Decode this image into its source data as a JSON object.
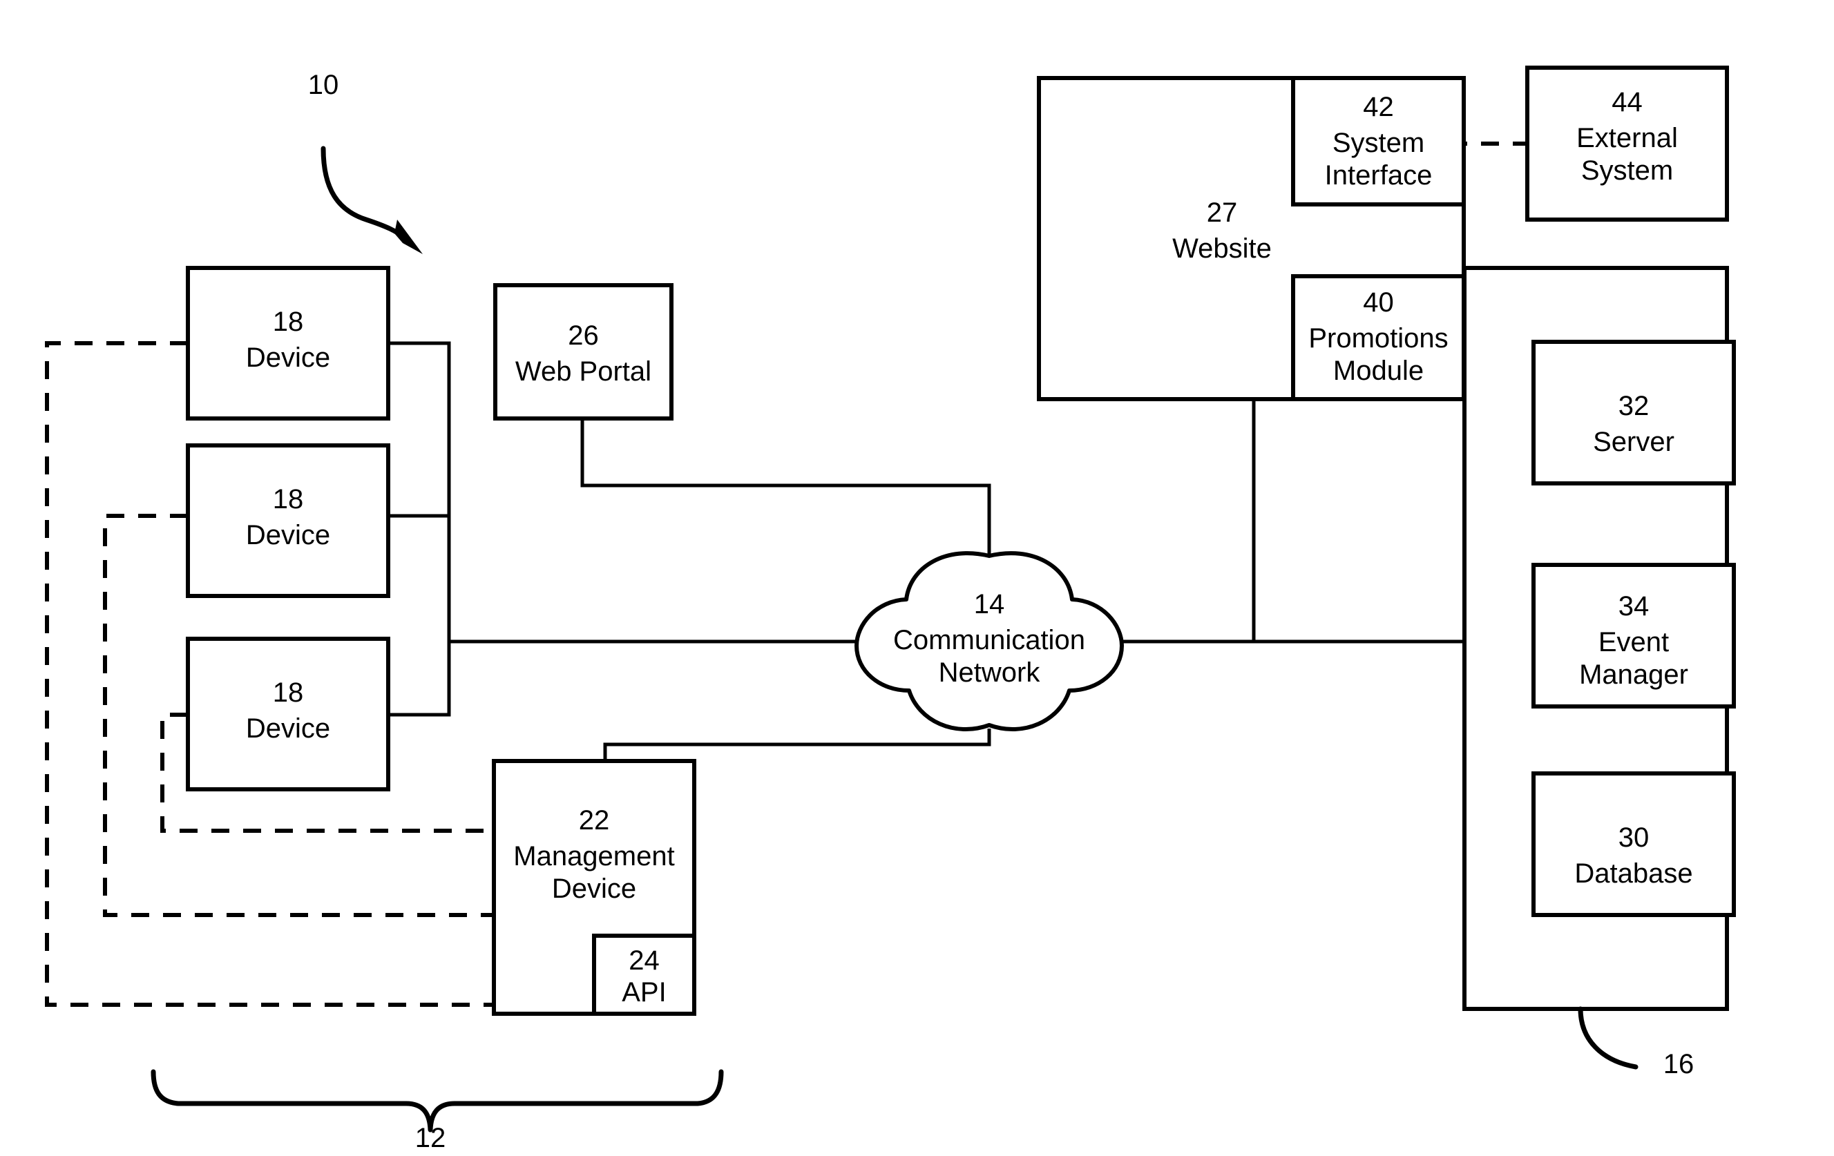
{
  "figure": {
    "overall_ref": "10",
    "left_group_ref": "12",
    "backend_group_ref": "16"
  },
  "nodes": {
    "device1": {
      "ref": "18",
      "label": "Device"
    },
    "device2": {
      "ref": "18",
      "label": "Device"
    },
    "device3": {
      "ref": "18",
      "label": "Device"
    },
    "web_portal": {
      "ref": "26",
      "label": "Web Portal"
    },
    "management_device": {
      "ref": "22",
      "label": "Management\nDevice"
    },
    "api": {
      "ref": "24",
      "label": "API"
    },
    "network": {
      "ref": "14",
      "label": "Communication\nNetwork"
    },
    "website": {
      "ref": "27",
      "label": "Website"
    },
    "system_interface": {
      "ref": "42",
      "label": "System\nInterface"
    },
    "promotions_module": {
      "ref": "40",
      "label": "Promotions\nModule"
    },
    "external_system": {
      "ref": "44",
      "label": "External\nSystem"
    },
    "server": {
      "ref": "32",
      "label": "Server"
    },
    "event_manager": {
      "ref": "34",
      "label": "Event\nManager"
    },
    "database": {
      "ref": "30",
      "label": "Database"
    }
  },
  "colors": {
    "stroke": "#000000",
    "fill": "#ffffff"
  }
}
